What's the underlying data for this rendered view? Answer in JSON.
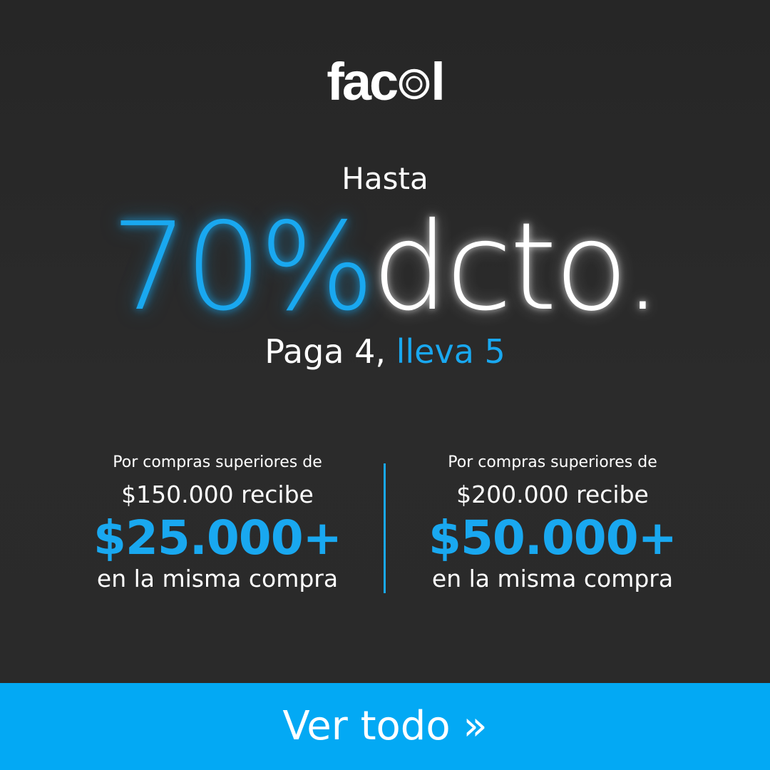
{
  "brand": {
    "logo_prefix": "fac",
    "logo_suffix": "l",
    "logo_mark_icon": "ring-o-icon",
    "accent_color": "#03a9f4"
  },
  "promo": {
    "intro": "Hasta",
    "percent": "70%",
    "discount_word": "dcto.",
    "paga_label": "Paga 4,",
    "lleva_label": "lleva 5"
  },
  "offers": [
    {
      "line1": "Por compras superiores de",
      "line2": "$150.000 recibe",
      "amount": "$25.000+",
      "line4": "en la misma compra"
    },
    {
      "line1": "Por compras superiores de",
      "line2": "$200.000 recibe",
      "amount": "$50.000+",
      "line4": "en la misma compra"
    }
  ],
  "cta": {
    "label": "Ver todo »"
  }
}
